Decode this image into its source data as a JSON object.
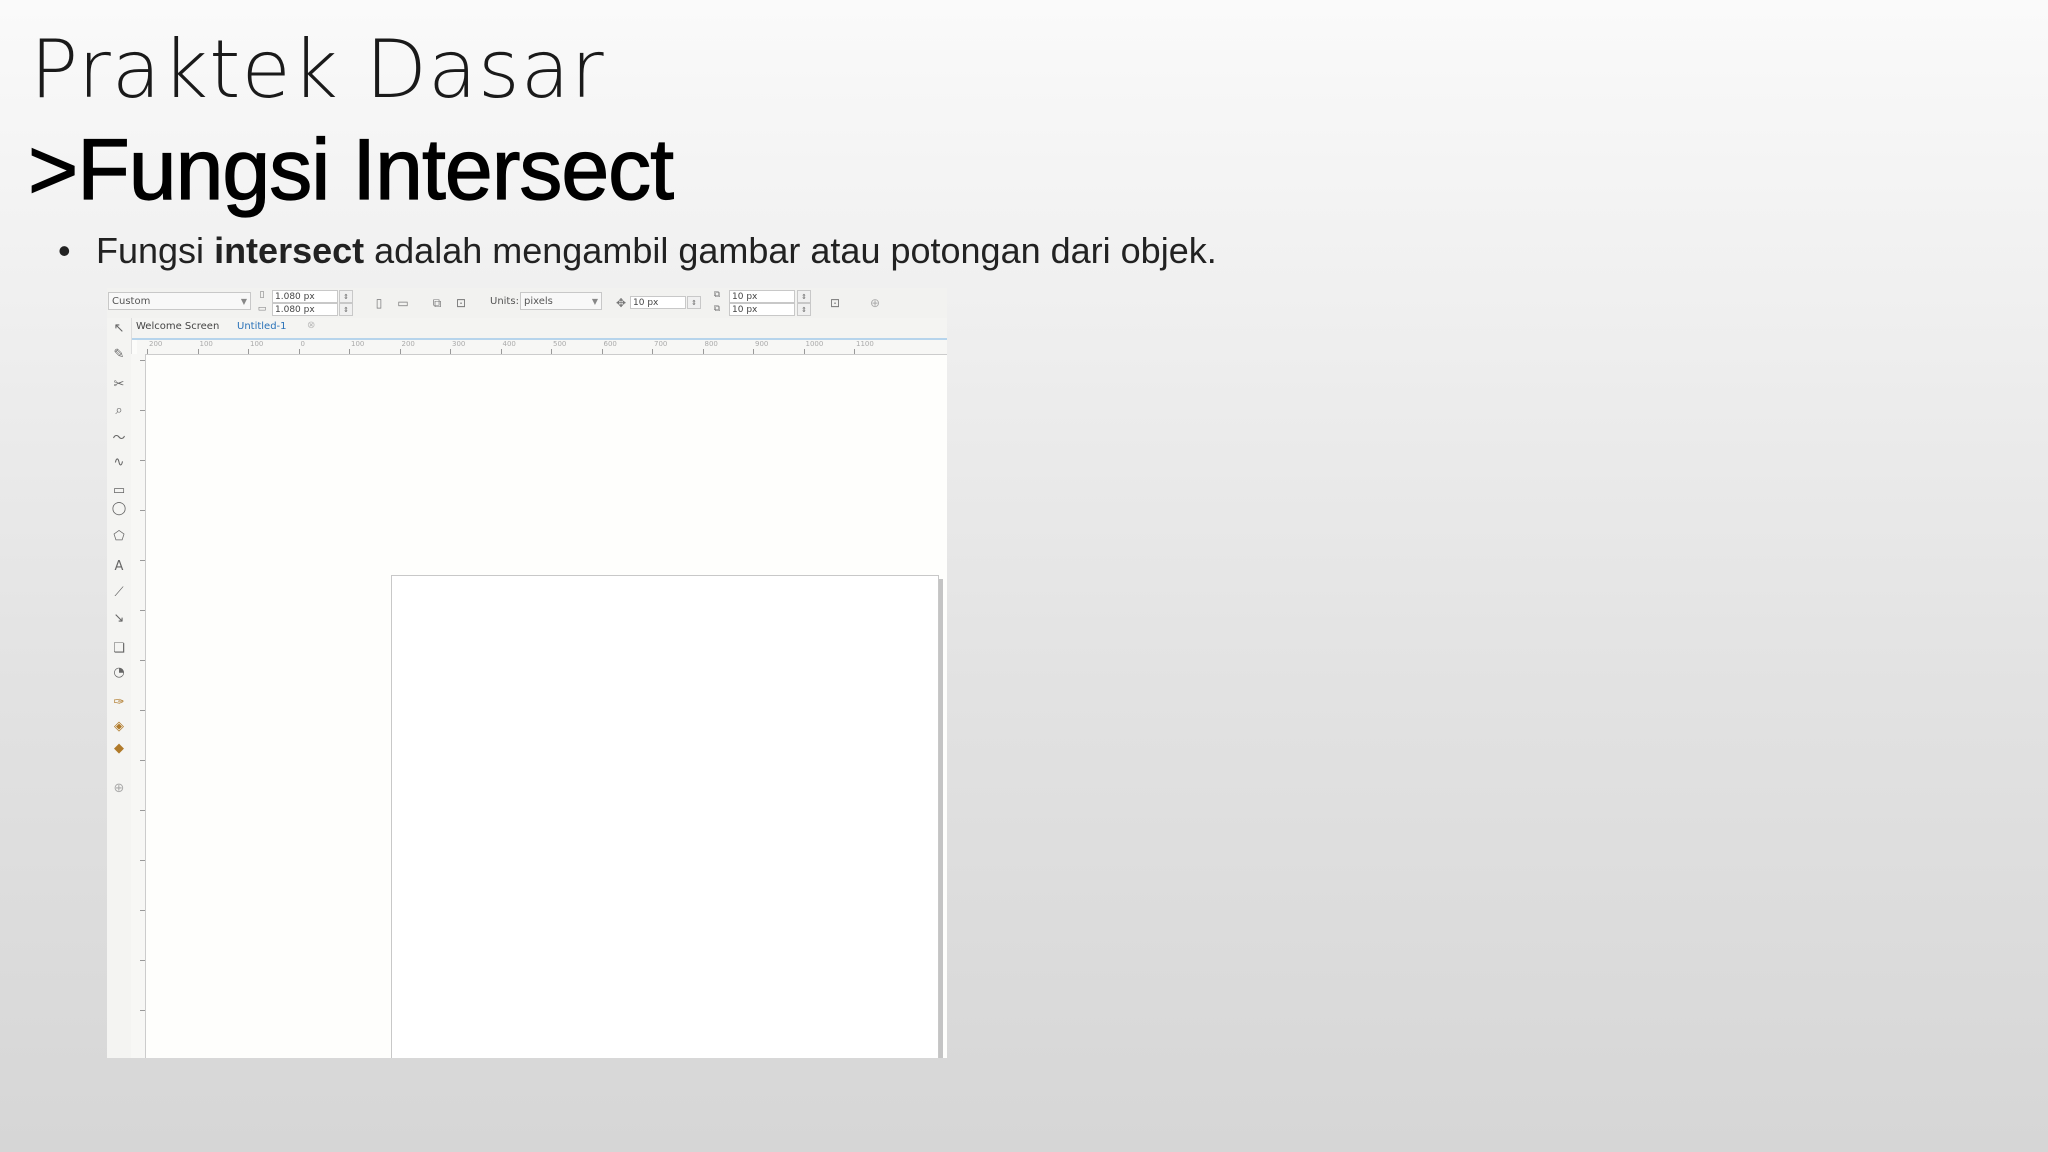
{
  "slide": {
    "title_line1": "Praktek Dasar",
    "title_line2": ">Fungsi Intersect",
    "bullet_prefix": "Fungsi ",
    "bullet_bold": "intersect",
    "bullet_suffix": " adalah mengambil gambar atau potongan dari objek."
  },
  "app": {
    "toolbar": {
      "preset": "Custom",
      "width": "1.080 px",
      "height": "1.080 px",
      "units_label": "Units:",
      "units_value": "pixels",
      "nudge": "10 px",
      "dup_x": "10 px",
      "dup_y": "10 px"
    },
    "tabs": {
      "welcome": "Welcome Screen",
      "document": "Untitled-1"
    },
    "ruler_labels": [
      "200",
      "100",
      "100",
      "0",
      "100",
      "200",
      "300",
      "400",
      "500",
      "600",
      "700",
      "800",
      "900",
      "1000",
      "1100"
    ]
  },
  "colors": {
    "active_tab": "#2a72b8",
    "tab_underline": "#b6d4ec"
  }
}
